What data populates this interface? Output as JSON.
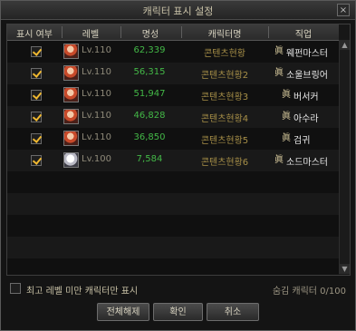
{
  "window": {
    "title": "캐릭터 표시 설정",
    "close_icon": "×"
  },
  "table": {
    "headers": [
      "표시 여부",
      "레벨",
      "명성",
      "캐릭터명",
      "직업"
    ],
    "rows": [
      {
        "checked": true,
        "level": "Lv.110",
        "fame": "62,339",
        "name": "콘텐츠현황",
        "job": "웨펀마스터",
        "avatar": "red"
      },
      {
        "checked": true,
        "level": "Lv.110",
        "fame": "56,315",
        "name": "콘텐츠현황2",
        "job": "소울브링어",
        "avatar": "red"
      },
      {
        "checked": true,
        "level": "Lv.110",
        "fame": "51,947",
        "name": "콘텐츠현황3",
        "job": "버서커",
        "avatar": "red"
      },
      {
        "checked": true,
        "level": "Lv.110",
        "fame": "46,828",
        "name": "콘텐츠현황4",
        "job": "아수라",
        "avatar": "red"
      },
      {
        "checked": true,
        "level": "Lv.110",
        "fame": "36,850",
        "name": "콘텐츠현황5",
        "job": "검귀",
        "avatar": "red"
      },
      {
        "checked": true,
        "level": "Lv.100",
        "fame": "7,584",
        "name": "콘텐츠현황6",
        "job": "소드마스터",
        "avatar": "white"
      }
    ],
    "job_icon": "眞",
    "empty_rows": 5
  },
  "footer": {
    "checkbox_label": "최고 레벨 미만 캐릭터만 표시",
    "checkbox_checked": false,
    "hidden_count": "숨김 캐릭터 0/100"
  },
  "buttons": {
    "unselect_all": "전체해제",
    "confirm": "확인",
    "cancel": "취소"
  },
  "scroll_icons": {
    "up": "▲",
    "down": "▼"
  },
  "colors": {
    "fame": "#43b847",
    "name": "#a89048",
    "check": "#f0b830"
  }
}
